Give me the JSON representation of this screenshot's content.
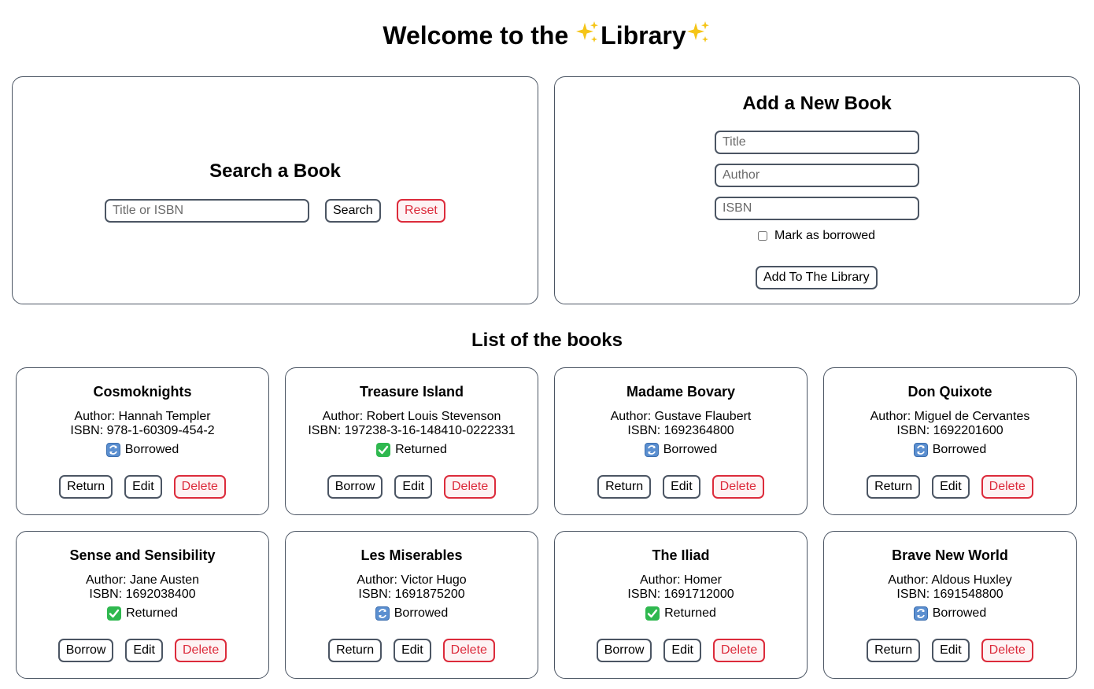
{
  "header": {
    "title_text": "Welcome to the ",
    "title_word": "Library"
  },
  "search": {
    "heading": "Search a Book",
    "placeholder": "Title or ISBN",
    "search_label": "Search",
    "reset_label": "Reset"
  },
  "add": {
    "heading": "Add a New Book",
    "title_placeholder": "Title",
    "author_placeholder": "Author",
    "isbn_placeholder": "ISBN",
    "borrowed_label": "Mark as borrowed",
    "submit_label": "Add To The Library"
  },
  "list": {
    "heading": "List of the books"
  },
  "books": [
    {
      "title": "Cosmoknights",
      "author": "Author: Hannah Templer",
      "isbn": "ISBN: 978-1-60309-454-2",
      "status": "Borrowed",
      "status_icon": "counterclockwise-arrows-icon",
      "action": "Return",
      "edit": "Edit",
      "delete": "Delete"
    },
    {
      "title": "Treasure Island",
      "author": "Author: Robert Louis Stevenson",
      "isbn": "ISBN: 197238-3-16-148410-0222331",
      "status": "Returned",
      "status_icon": "check-mark-icon",
      "action": "Borrow",
      "edit": "Edit",
      "delete": "Delete"
    },
    {
      "title": "Madame Bovary",
      "author": "Author: Gustave Flaubert",
      "isbn": "ISBN: 1692364800",
      "status": "Borrowed",
      "status_icon": "counterclockwise-arrows-icon",
      "action": "Return",
      "edit": "Edit",
      "delete": "Delete"
    },
    {
      "title": "Don Quixote",
      "author": "Author: Miguel de Cervantes",
      "isbn": "ISBN: 1692201600",
      "status": "Borrowed",
      "status_icon": "counterclockwise-arrows-icon",
      "action": "Return",
      "edit": "Edit",
      "delete": "Delete"
    },
    {
      "title": "Sense and Sensibility",
      "author": "Author: Jane Austen",
      "isbn": "ISBN: 1692038400",
      "status": "Returned",
      "status_icon": "check-mark-icon",
      "action": "Borrow",
      "edit": "Edit",
      "delete": "Delete"
    },
    {
      "title": "Les Miserables",
      "author": "Author: Victor Hugo",
      "isbn": "ISBN: 1691875200",
      "status": "Borrowed",
      "status_icon": "counterclockwise-arrows-icon",
      "action": "Return",
      "edit": "Edit",
      "delete": "Delete"
    },
    {
      "title": "The Iliad",
      "author": "Author: Homer",
      "isbn": "ISBN: 1691712000",
      "status": "Returned",
      "status_icon": "check-mark-icon",
      "action": "Borrow",
      "edit": "Edit",
      "delete": "Delete"
    },
    {
      "title": "Brave New World",
      "author": "Author: Aldous Huxley",
      "isbn": "ISBN: 1691548800",
      "status": "Borrowed",
      "status_icon": "counterclockwise-arrows-icon",
      "action": "Return",
      "edit": "Edit",
      "delete": "Delete"
    }
  ],
  "colors": {
    "border": "#4b5563",
    "danger": "#dc2b3b",
    "sparkle": "#f5c518",
    "returned_icon": "#2fb84f",
    "borrowed_icon": "#5b8fd0"
  }
}
